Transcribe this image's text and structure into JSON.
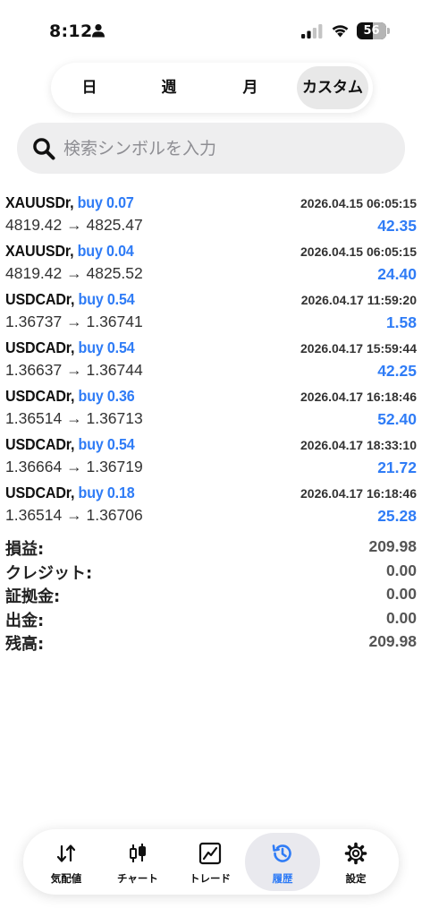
{
  "status_bar": {
    "time": "8:12",
    "battery": "56",
    "battery_level": 0.56
  },
  "period_tabs": [
    {
      "label": "日",
      "active": false
    },
    {
      "label": "週",
      "active": false
    },
    {
      "label": "月",
      "active": false
    },
    {
      "label": "カスタム",
      "active": true
    }
  ],
  "search": {
    "placeholder": "検索シンボルを入力",
    "value": ""
  },
  "trades": [
    {
      "symbol": "XAUUSDr",
      "side": "buy 0.07",
      "time": "2026.04.15 06:05:15",
      "prices": "4819.42 → 4825.47",
      "profit": "42.35"
    },
    {
      "symbol": "XAUUSDr",
      "side": "buy 0.04",
      "time": "2026.04.15 06:05:15",
      "prices": "4819.42 → 4825.52",
      "profit": "24.40"
    },
    {
      "symbol": "USDCADr",
      "side": "buy 0.54",
      "time": "2026.04.17 11:59:20",
      "prices": "1.36737 → 1.36741",
      "profit": "1.58"
    },
    {
      "symbol": "USDCADr",
      "side": "buy 0.54",
      "time": "2026.04.17 15:59:44",
      "prices": "1.36637 → 1.36744",
      "profit": "42.25"
    },
    {
      "symbol": "USDCADr",
      "side": "buy 0.36",
      "time": "2026.04.17 16:18:46",
      "prices": "1.36514 → 1.36713",
      "profit": "52.40"
    },
    {
      "symbol": "USDCADr",
      "side": "buy 0.54",
      "time": "2026.04.17 18:33:10",
      "prices": "1.36664 → 1.36719",
      "profit": "21.72"
    },
    {
      "symbol": "USDCADr",
      "side": "buy 0.18",
      "time": "2026.04.17 16:18:46",
      "prices": "1.36514 → 1.36706",
      "profit": "25.28"
    }
  ],
  "summary": {
    "profit_label": "損益:",
    "profit_value": "209.98",
    "credit_label": "クレジット:",
    "credit_value": "0.00",
    "margin_label": "証拠金:",
    "margin_value": "0.00",
    "withdrawal_label": "出金:",
    "withdrawal_value": "0.00",
    "balance_label": "残高:",
    "balance_value": "209.98"
  },
  "nav": [
    {
      "label": "気配値",
      "icon": "quotes-icon",
      "active": false
    },
    {
      "label": "チャート",
      "icon": "candlestick-chart-icon",
      "active": false
    },
    {
      "label": "トレード",
      "icon": "trade-chart-icon",
      "active": false
    },
    {
      "label": "履歴",
      "icon": "history-icon",
      "active": true
    },
    {
      "label": "設定",
      "icon": "gear-icon",
      "active": false
    }
  ],
  "colors": {
    "accent": "#2f7cf6",
    "text": "#111111",
    "muted": "#8e8e93",
    "active_pill": "#e9e9ee",
    "search_bg": "#eeeeef"
  }
}
